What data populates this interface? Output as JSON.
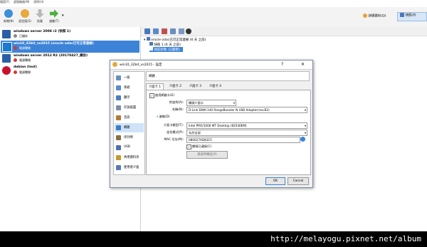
{
  "menubar": {
    "items": [
      "檔案(F)",
      "虛擬機器(M)",
      "說明(H)"
    ]
  },
  "toolbar": {
    "buttons": [
      {
        "label": "新增(N)",
        "icon": "new-icon",
        "color": "#3b8ed8"
      },
      {
        "label": "設定值(S)",
        "icon": "settings-icon",
        "color": "#e6a93a"
      },
      {
        "label": "捨棄",
        "icon": "discard-icon",
        "color": "#9a9a9a"
      },
      {
        "label": "啟動(T)",
        "icon": "start-icon",
        "color": "#4caf3c"
      }
    ]
  },
  "detail_button": "詳細資料(D)",
  "snapshot_button": "快照(P)",
  "vms": [
    {
      "name": "windows server 2008 r2 (快照 1)",
      "status": "已儲存",
      "os_color": "#2a5fa8",
      "status_color": "#555"
    },
    {
      "name": "win10_32bit_vs2015 (oracle odac已可正常連線)",
      "status": "電源關閉",
      "os_color": "#1a79d0",
      "status_color": "#d43a2a",
      "selected": true
    },
    {
      "name": "windows server 2012 R2 (20170427_備份)",
      "status": "電源關閉",
      "os_color": "#2a5fa8",
      "status_color": "#d43a2a"
    },
    {
      "name": "debian (test)",
      "status": "電源關閉",
      "os_color": "#c8102e",
      "status_color": "#d43a2a"
    }
  ],
  "snapshots": {
    "root": "oracle odac已可正常連線 (6 天 之前)",
    "child": "快照 1 (6 天 之前)",
    "current": "目前狀態 (已變更)"
  },
  "dialog": {
    "title": "win10_32bit_vs2015 - 設定",
    "help": "?",
    "close": "✕",
    "header": "網路",
    "categories": [
      "一般",
      "系統",
      "顯示",
      "存放裝置",
      "音訊",
      "網路",
      "序列埠",
      "USB",
      "共用資料夾",
      "使用者介面"
    ],
    "category_colors": [
      "#6a8fbf",
      "#5a8cc8",
      "#4a7cc0",
      "#7b8fa6",
      "#b27a3c",
      "#3c7cc8",
      "#8a6f45",
      "#4f6fb0",
      "#c29a2c",
      "#5a7ab0"
    ],
    "tabs": [
      "介面卡 1",
      "介面卡 2",
      "介面卡 3",
      "介面卡 4"
    ],
    "enable_label": "啟用網路卡(E)",
    "attached_label": "附加到(A):",
    "attached_value": "橋接介面卡",
    "name_label": "名稱(N):",
    "name_value": "D-Link DWA-140 RangeBooster N USB Adapter(rev.B2)",
    "advanced_label": "進階(D)",
    "adapter_type_label": "介面卡類型(T):",
    "adapter_type_value": "Intel PRO/1000 MT Desktop (82540EM)",
    "promiscuous_label": "混合模式(P):",
    "promiscuous_value": "允許全部",
    "mac_label": "MAC 位址(M):",
    "mac_value": "080027AD8315",
    "cable_label": "纜線已連接(C)",
    "port_forward_button": "連接埠轉送(P)",
    "ok": "OK",
    "cancel": "Cancel"
  },
  "watermark": "http://melayogu.pixnet.net/album",
  "colors": {
    "selection": "#3d84d8",
    "accent": "#1a79d0"
  }
}
